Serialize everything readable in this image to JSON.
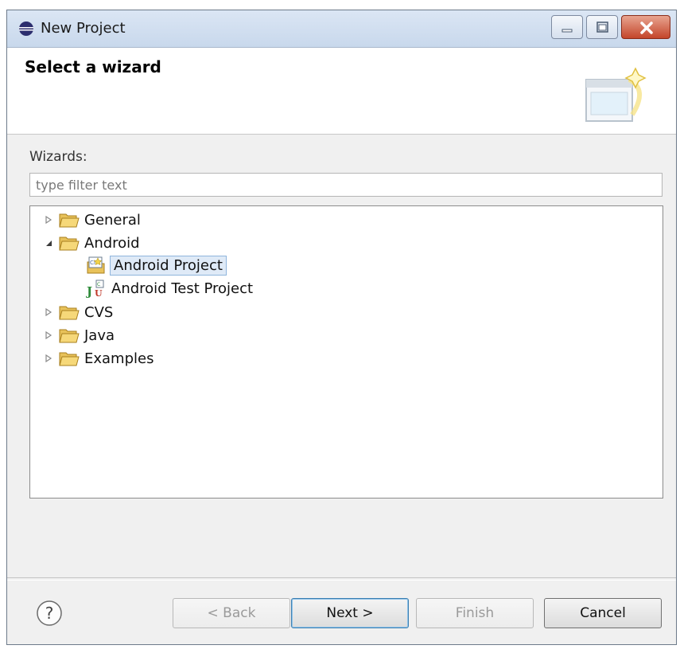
{
  "window": {
    "title": "New Project"
  },
  "header": {
    "title": "Select a wizard"
  },
  "wizards": {
    "label": "Wizards:",
    "filter_placeholder": "type filter text",
    "filter_value": ""
  },
  "tree": {
    "general": {
      "label": "General",
      "expanded": false
    },
    "android": {
      "label": "Android",
      "expanded": true,
      "children": [
        {
          "label": "Android Project",
          "selected": true,
          "icon": "android-project-icon"
        },
        {
          "label": "Android Test Project",
          "selected": false,
          "icon": "junit-icon"
        }
      ]
    },
    "cvs": {
      "label": "CVS",
      "expanded": false
    },
    "java": {
      "label": "Java",
      "expanded": false
    },
    "examples": {
      "label": "Examples",
      "expanded": false
    }
  },
  "buttons": {
    "back": "< Back",
    "next": "Next >",
    "finish": "Finish",
    "cancel": "Cancel"
  },
  "colors": {
    "selection": "#dfeaf7",
    "folder": "#e8c25a",
    "close_button": "#c4452a"
  }
}
